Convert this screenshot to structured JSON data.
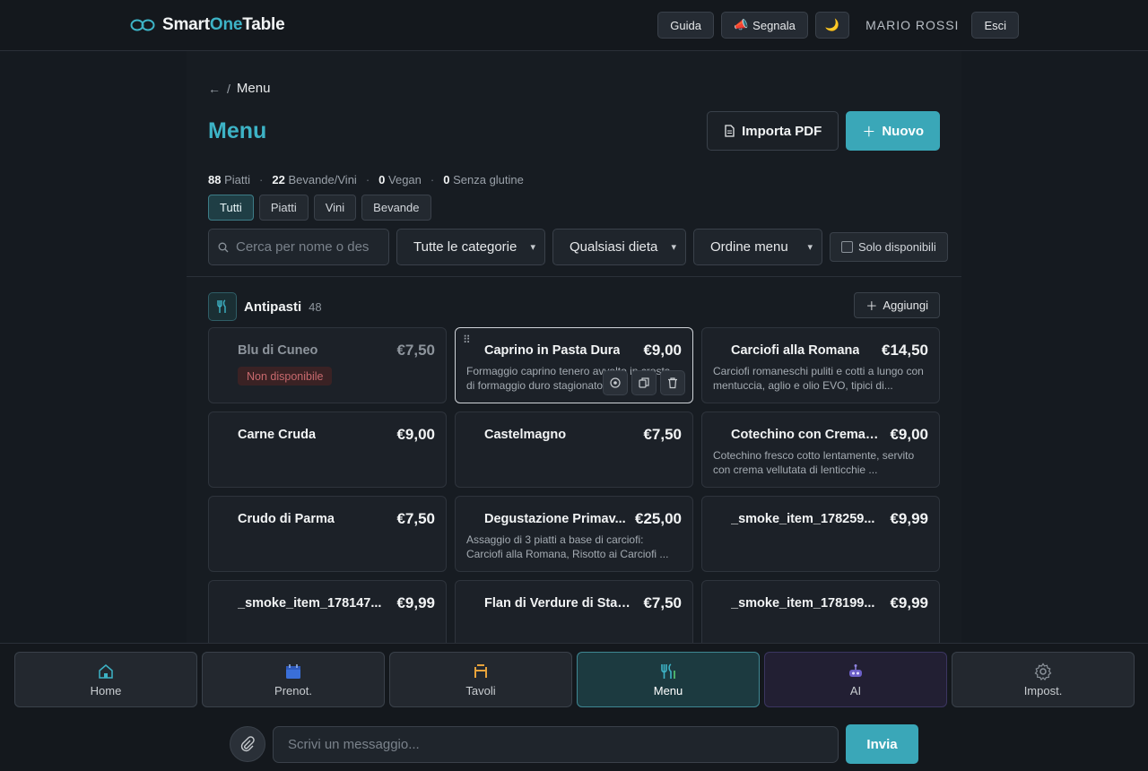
{
  "app": {
    "brand_part1": "Smart",
    "brand_part2": "One",
    "brand_part3": "Table",
    "accent": "#3db3c6"
  },
  "topbar": {
    "guide_label": "Guida",
    "report_label": "Segnala",
    "report_icon": "megaphone-icon",
    "theme_icon": "moon-icon",
    "theme_glyph": "🌙",
    "user_name": "MARIO ROSSI",
    "logout_label": "Esci"
  },
  "breadcrumb": {
    "back_glyph": "←",
    "sep": "/",
    "current": "Menu"
  },
  "page": {
    "title": "Menu",
    "import_label": "Importa PDF",
    "new_label": "Nuovo"
  },
  "stats": {
    "dishes_count": "88",
    "dishes_label": "Piatti",
    "drinks_count": "22",
    "drinks_label": "Bevande/Vini",
    "vegan_count": "0",
    "vegan_label": "Vegan",
    "gluten_count": "0",
    "gluten_label": "Senza glutine",
    "sep": "·"
  },
  "filters": {
    "tabs": [
      "Tutti",
      "Piatti",
      "Vini",
      "Bevande"
    ],
    "active_tab": "Tutti",
    "search_placeholder": "Cerca per nome o des",
    "category_value": "Tutte le categorie",
    "diet_value": "Qualsiasi dieta",
    "order_value": "Ordine menu",
    "only_available_label": "Solo disponibili",
    "only_available_checked": false
  },
  "section": {
    "title": "Antipasti",
    "count": "48",
    "icon": "utensils-icon",
    "add_label": "Aggiungi"
  },
  "items": [
    {
      "name": "Blu di Cuneo",
      "price": "€7,50",
      "desc": "",
      "badge": "Non disponibile",
      "available": false
    },
    {
      "name": "Caprino in Pasta Dura",
      "price": "€9,00",
      "desc": "Formaggio caprino tenero avvolto in crosta di formaggio duro stagionato...",
      "badge": "",
      "available": true,
      "selected": true
    },
    {
      "name": "Carciofi alla Romana",
      "price": "€14,50",
      "desc": "Carciofi romaneschi puliti e cotti a lungo con mentuccia, aglio e olio EVO, tipici di...",
      "badge": "",
      "available": true
    },
    {
      "name": "Carne Cruda",
      "price": "€9,00",
      "desc": "",
      "badge": "",
      "available": true
    },
    {
      "name": "Castelmagno",
      "price": "€7,50",
      "desc": "",
      "badge": "",
      "available": true
    },
    {
      "name": "Cotechino con Crema ...",
      "price": "€9,00",
      "desc": "Cotechino fresco cotto lentamente, servito con crema vellutata di lenticchie ...",
      "badge": "",
      "available": true
    },
    {
      "name": "Crudo di Parma",
      "price": "€7,50",
      "desc": "",
      "badge": "",
      "available": true
    },
    {
      "name": "Degustazione Primav...",
      "price": "€25,00",
      "desc": "Assaggio di 3 piatti a base di carciofi: Carciofi alla Romana, Risotto ai Carciofi ...",
      "badge": "",
      "available": true
    },
    {
      "name": "_smoke_item_178259...",
      "price": "€9,99",
      "desc": "",
      "badge": "",
      "available": true
    },
    {
      "name": "_smoke_item_178147...",
      "price": "€9,99",
      "desc": "",
      "badge": "",
      "available": true
    },
    {
      "name": "Flan di Verdure di Stagi...",
      "price": "€7,50",
      "desc": "",
      "badge": "",
      "available": true
    },
    {
      "name": "_smoke_item_178199...",
      "price": "€9,99",
      "desc": "",
      "badge": "",
      "available": true
    }
  ],
  "bottom_nav": [
    {
      "label": "Home",
      "icon": "home-icon",
      "active": false
    },
    {
      "label": "Prenot.",
      "icon": "calendar-icon",
      "active": false
    },
    {
      "label": "Tavoli",
      "icon": "table-icon",
      "active": false
    },
    {
      "label": "Menu",
      "icon": "utensils-icon",
      "active": true
    },
    {
      "label": "AI",
      "icon": "robot-icon",
      "active": false
    },
    {
      "label": "Impost.",
      "icon": "gear-icon",
      "active": false
    }
  ],
  "chat": {
    "placeholder": "Scrivi un messaggio...",
    "send_label": "Invia"
  }
}
